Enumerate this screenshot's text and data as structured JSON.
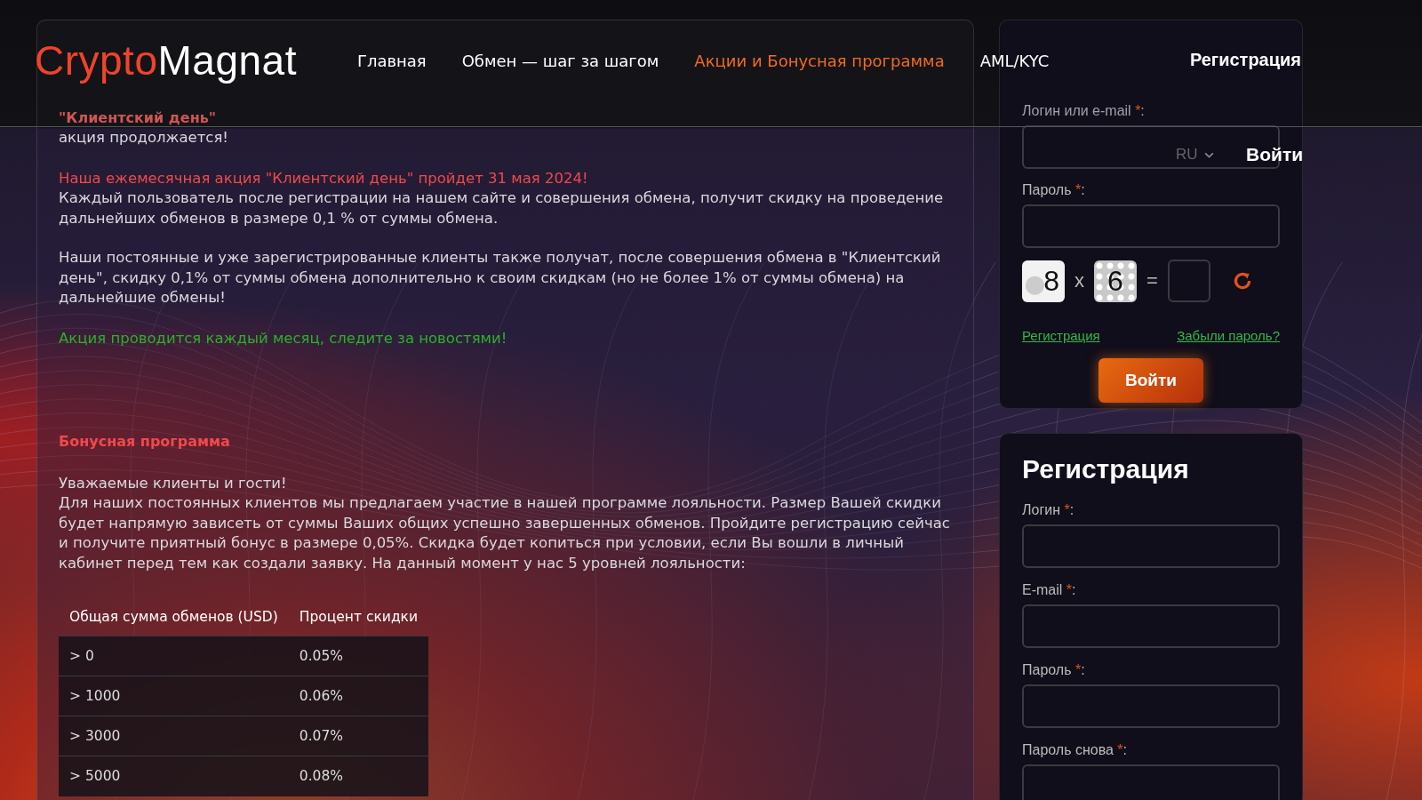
{
  "header": {
    "logo": {
      "parts": [
        {
          "text": "Crypto",
          "accent": true
        },
        {
          "text": "Magnat",
          "accent": false
        }
      ]
    },
    "nav": [
      {
        "label": "Главная",
        "selected": false
      },
      {
        "label": "Обмен — шаг за шагом",
        "selected": false
      },
      {
        "label": "Акции и Бонусная программа",
        "selected": true
      },
      {
        "label": "AML/KYC",
        "selected": false
      }
    ],
    "register_link": "Регистрация",
    "language": "RU",
    "login_link": "Войти"
  },
  "promo": {
    "title": "\"Клиентский день\"",
    "subtitle": "акция продолжается!",
    "headline": "Наша ежемесячная акция \"Клиентский день\" пройдет 31 мая 2024!",
    "paragraphs": [
      "Каждый пользователь после регистрации на нашем сайте и совершения обмена, получит скидку на проведение дальнейших обменов в размере 0,1 % от суммы обмена.",
      "Наши постоянные и уже зарегистрированные клиенты также получат, после совершения обмена в \"Клиентский день\", скидку 0,1% от суммы обмена дополнительно к своим скидкам (но не более 1% от суммы обмена) на дальнейшие обмены!"
    ],
    "notice": "Акция проводится каждый месяц, следите за новостями!"
  },
  "bonus": {
    "title": "Бонусная программа",
    "greeting": "Уважаемые клиенты и гости!",
    "text": "Для наших постоянных клиентов мы предлагаем участие в нашей программе лояльности. Размер Вашей скидки будет напрямую зависеть от суммы Ваших общих успешно завершенных обменов. Пройдите регистрацию сейчас и получите приятный бонус в размере 0,05%. Скидка будет копиться при условии, если Вы вошли в личный кабинет перед тем как создали заявку. На данный момент у нас 5 уровней лояльности:",
    "table": {
      "columns": [
        "Общая сумма обменов (USD)",
        "Процент скидки"
      ],
      "rows": [
        [
          "> 0",
          "0.05%"
        ],
        [
          "> 1000",
          "0.06%"
        ],
        [
          "> 3000",
          "0.07%"
        ],
        [
          "> 5000",
          "0.08%"
        ]
      ]
    }
  },
  "login": {
    "fields": [
      {
        "label": "Логин или e-mail",
        "mark": "*",
        "suffix": ":"
      },
      {
        "label": "Пароль",
        "mark": "*",
        "suffix": ":"
      }
    ],
    "captcha": {
      "a": "8",
      "op": "x",
      "b": "6",
      "eq": "="
    },
    "register_link": "Регистрация",
    "forgot_link": "Забыли пароль?",
    "submit": "Войти"
  },
  "registration": {
    "title": "Регистрация",
    "fields": [
      {
        "label": "Логин",
        "mark": "*",
        "suffix": ":"
      },
      {
        "label": "E-mail",
        "mark": "*",
        "suffix": ":"
      },
      {
        "label": "Пароль",
        "mark": "*",
        "suffix": ":"
      },
      {
        "label": "Пароль снова",
        "mark": "*",
        "suffix": ":"
      }
    ]
  }
}
